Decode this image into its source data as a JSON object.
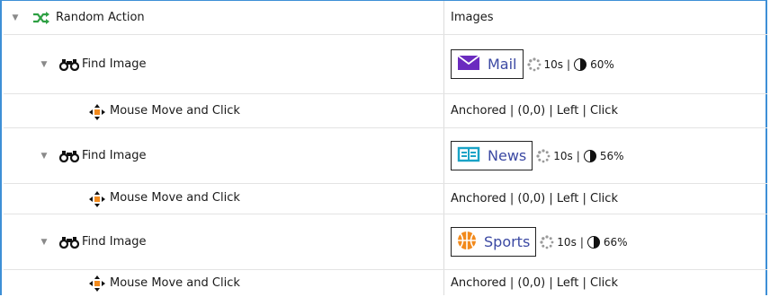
{
  "header": {
    "name": "Random Action",
    "value": "Images"
  },
  "rows": [
    {
      "name": "Find Image",
      "thumb_label": "Mail",
      "timeout": "10s",
      "threshold": "60%"
    },
    {
      "name": "Mouse Move and Click",
      "value": "Anchored |  (0,0) | Left | Click"
    },
    {
      "name": "Find Image",
      "thumb_label": "News",
      "timeout": "10s",
      "threshold": "56%"
    },
    {
      "name": "Mouse Move and Click",
      "value": "Anchored |  (0,0) | Left | Click"
    },
    {
      "name": "Find Image",
      "thumb_label": "Sports",
      "timeout": "10s",
      "threshold": "66%"
    },
    {
      "name": "Mouse Move and Click",
      "value": "Anchored |  (0,0) | Left | Click"
    }
  ],
  "icons": {
    "random": "shuffle-icon",
    "find": "binoculars-icon",
    "move": "move-arrows-icon",
    "mail": "envelope-icon",
    "news": "newspaper-icon",
    "sports": "basketball-icon",
    "timeout": "spinner-icon",
    "threshold": "contrast-icon"
  },
  "colors": {
    "accent_border": "#3d8fd6",
    "shuffle_green": "#2ea043",
    "mail_purple": "#6b2bbf",
    "news_teal": "#1aa3c6",
    "sports_orange": "#f28a1c"
  }
}
